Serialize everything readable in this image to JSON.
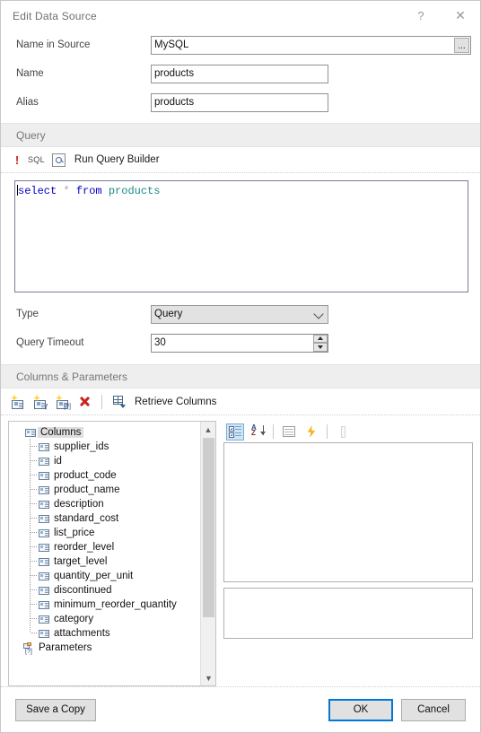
{
  "window": {
    "title": "Edit Data Source",
    "help_label": "?",
    "close_label": "✕"
  },
  "form": {
    "name_in_source": {
      "label": "Name in Source",
      "value": "MySQL",
      "browse_label": "..."
    },
    "name": {
      "label": "Name",
      "value": "products"
    },
    "alias": {
      "label": "Alias",
      "value": "products"
    }
  },
  "query_section": {
    "header": "Query",
    "warning_icon": "!",
    "sql_tag": "SQL",
    "query_builder_icon": "magnifier-icon",
    "run_query_builder_label": "Run Query Builder",
    "sql": {
      "keyword1": "select",
      "star": "*",
      "keyword2": "from",
      "table": "products"
    },
    "type": {
      "label": "Type",
      "value": "Query"
    },
    "query_timeout": {
      "label": "Query Timeout",
      "value": "30"
    }
  },
  "columns_section": {
    "header": "Columns & Parameters",
    "toolbar": {
      "add_column_label": "add-column",
      "add_calculated_column_label": "add-calculated-column",
      "add_parameter_label": "add-parameter",
      "delete_label": "delete",
      "retrieve_columns_label": "Retrieve Columns"
    },
    "tree": {
      "root": "Columns",
      "items": [
        "supplier_ids",
        "id",
        "product_code",
        "product_name",
        "description",
        "standard_cost",
        "list_price",
        "reorder_level",
        "target_level",
        "quantity_per_unit",
        "discontinued",
        "minimum_reorder_quantity",
        "category",
        "attachments"
      ],
      "parameters": "Parameters"
    },
    "property_toolbar": {
      "categorized_label": "categorized-view",
      "alphabetical_label": "alphabetical-sort",
      "properties_label": "properties-view",
      "events_label": "events-view",
      "disabled_label": "disabled-tool"
    }
  },
  "footer": {
    "save_a_copy": "Save a Copy",
    "ok": "OK",
    "cancel": "Cancel"
  },
  "colors": {
    "accent": "#0078d7",
    "section_header_bg": "#eeeeee",
    "warning": "#cf2020",
    "sql_keyword": "#0000c8",
    "sql_table": "#1b8a8a"
  }
}
